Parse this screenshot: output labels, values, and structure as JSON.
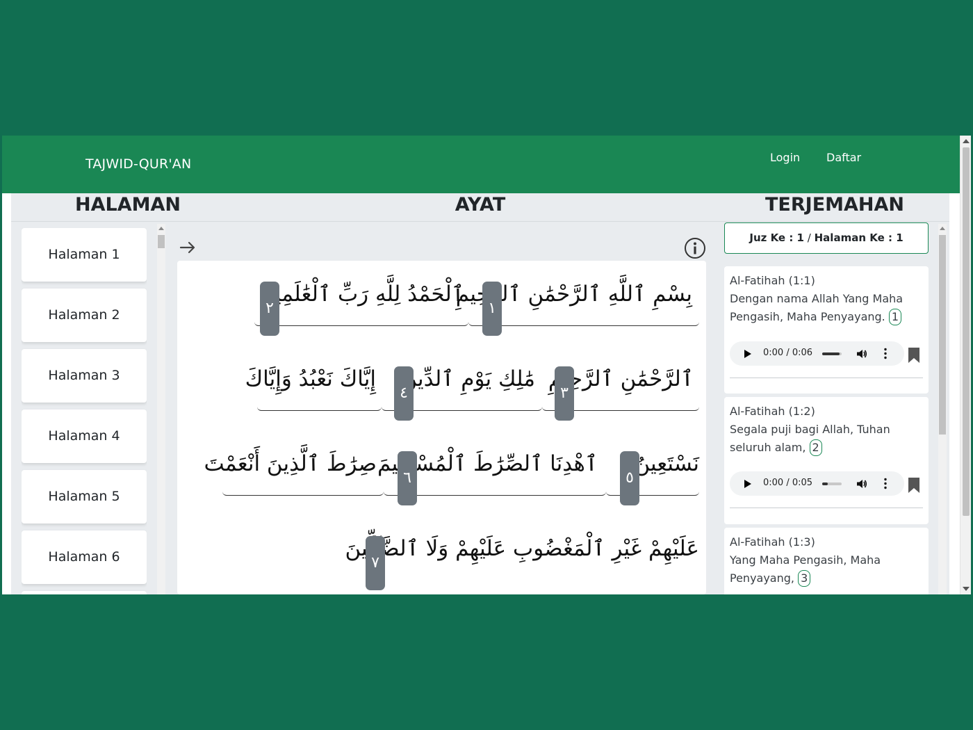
{
  "navbar": {
    "brand": "TAJWID-QUR'AN",
    "login": "Login",
    "daftar": "Daftar"
  },
  "headers": {
    "halaman": "HALAMAN",
    "ayat": "AYAT",
    "terjemahan": "TERJEMAHAN"
  },
  "halaman_items": [
    "Halaman 1",
    "Halaman 2",
    "Halaman 3",
    "Halaman 4",
    "Halaman 5",
    "Halaman 6"
  ],
  "ayat_lines": [
    {
      "segments": [
        {
          "text": "بِسْمِ ٱللَّهِ ٱلرَّحْمَٰنِ ٱلرَّحِيمِ",
          "number": "١"
        },
        {
          "text": "ٱلْحَمْدُ لِلَّهِ رَبِّ ٱلْعَٰلَمِينَ",
          "number": "٢"
        }
      ]
    },
    {
      "segments": [
        {
          "text": "ٱلرَّحْمَٰنِ ٱلرَّحِيمِ",
          "number": "٣"
        },
        {
          "text": "مَٰلِكِ يَوْمِ ٱلدِّينِ",
          "number": "٤"
        },
        {
          "text": "إِيَّاكَ نَعْبُدُ وَإِيَّاكَ",
          "number": ""
        }
      ]
    },
    {
      "segments": [
        {
          "text": "نَسْتَعِينُ",
          "number": "٥"
        },
        {
          "text": "ٱهْدِنَا ٱلصِّرَٰطَ ٱلْمُسْتَقِيمَ",
          "number": "٦"
        },
        {
          "text": "صِرَٰطَ ٱلَّذِينَ أَنْعَمْتَ",
          "number": ""
        }
      ]
    },
    {
      "segments": [
        {
          "text": "عَلَيْهِمْ غَيْرِ ٱلْمَغْضُوبِ عَلَيْهِمْ وَلَا ٱلضَّآلِّينَ",
          "number": "٧"
        }
      ]
    }
  ],
  "juz": {
    "juz_label": "Juz Ke : 1",
    "separator": "/",
    "halaman_label": "Halaman Ke : 1"
  },
  "terjemahan": [
    {
      "ref": "Al-Fatihah (1:1)",
      "text": "Dengan nama Allah Yang Maha Pengasih, Maha Penyayang.",
      "num": "1",
      "time": "0:00 / 0:06",
      "progress": 0.9
    },
    {
      "ref": "Al-Fatihah (1:2)",
      "text": "Segala puji bagi Allah, Tuhan seluruh alam,",
      "num": "2",
      "time": "0:00 / 0:05",
      "progress": 0.3
    },
    {
      "ref": "Al-Fatihah (1:3)",
      "text": "Yang Maha Pengasih, Maha Penyayang,",
      "num": "3"
    }
  ],
  "icons": {
    "next_arrow": "arrow-right-icon",
    "info": "info-circle-icon",
    "play": "play-icon",
    "volume": "volume-icon",
    "more": "more-vertical-icon",
    "bookmark": "bookmark-icon"
  },
  "colors": {
    "background": "#116e51",
    "navbar": "#1a8754",
    "accent_green": "#198754",
    "ayat_number_bg": "#6c757d",
    "tajwid_blue": "#2f59d6"
  }
}
